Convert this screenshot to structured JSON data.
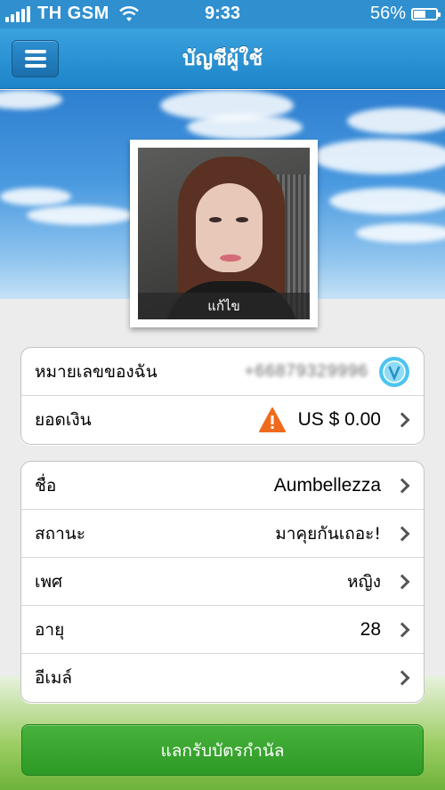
{
  "status_bar": {
    "carrier": "TH GSM",
    "time": "9:33",
    "battery": "56%",
    "battery_level": 0.56
  },
  "nav": {
    "title": "บัญชีผู้ใช้"
  },
  "profile": {
    "edit_label": "แก้ไข"
  },
  "account": {
    "phone_label": "หมายเลขของฉัน",
    "phone_value": "+66879329996",
    "balance_label": "ยอดเงิน",
    "balance_value": "US $ 0.00"
  },
  "info": {
    "rows": [
      {
        "label": "ชื่อ",
        "value": "Aumbellezza"
      },
      {
        "label": "สถานะ",
        "value": "มาคุยกันเถอะ!"
      },
      {
        "label": "เพศ",
        "value": "หญิง"
      },
      {
        "label": "อายุ",
        "value": "28"
      },
      {
        "label": "อีเมล์",
        "value": ""
      }
    ]
  },
  "redeem_button": {
    "label": "แลกรับบัตรกำนัล"
  },
  "colors": {
    "nav": "#1c84c8",
    "button": "#2d9a25",
    "warning": "#f06a1e",
    "verified": "#4cc4f0"
  }
}
